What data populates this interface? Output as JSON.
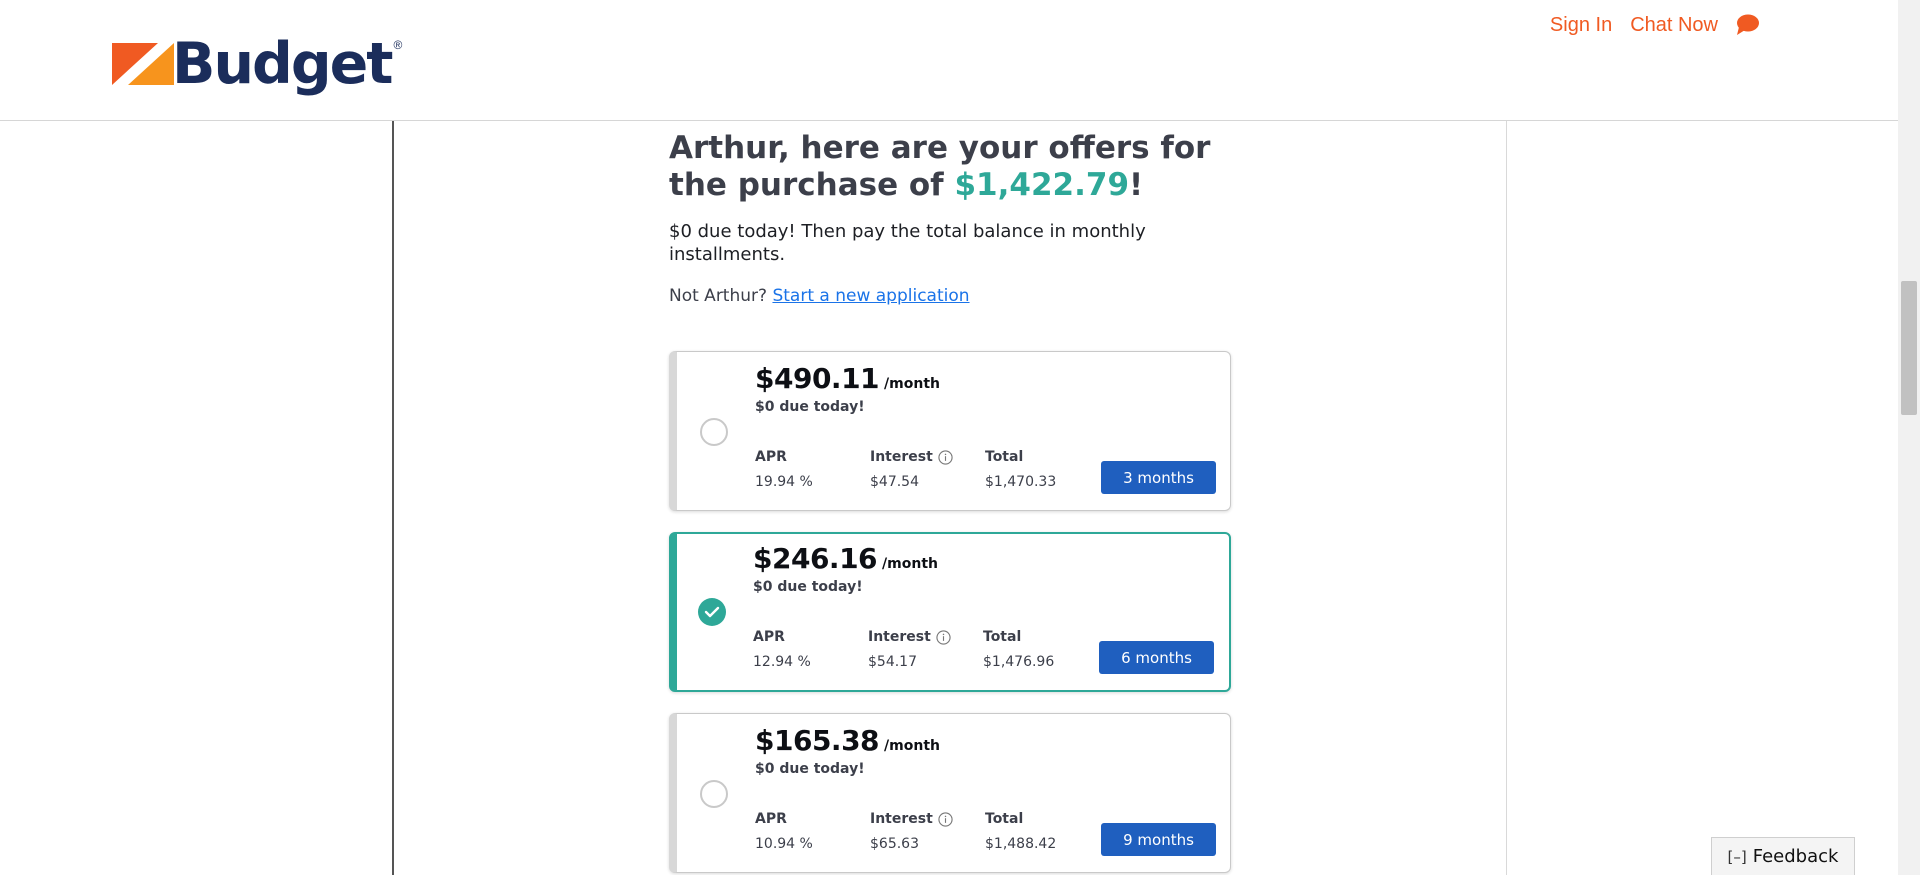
{
  "header": {
    "logo_text": "Budget",
    "logo_registered": "®",
    "sign_in": "Sign In",
    "chat_now": "Chat Now",
    "brand_color": "#f05a22",
    "logo_color": "#1b2d5b"
  },
  "main": {
    "headline_prefix": "Arthur, here are your offers for the purchase of ",
    "headline_amount": "$1,422.79",
    "headline_suffix": "!",
    "subtext": "$0 due today! Then pay the total balance in monthly installments.",
    "not_user_prefix": "Not Arthur?",
    "start_new_application": "Start a new application",
    "accent_color": "#2ea898"
  },
  "offers": [
    {
      "price": "$490.11",
      "per_month": "/month",
      "due_today": "$0 due today!",
      "apr_label": "APR",
      "apr_value": "19.94 %",
      "interest_label": "Interest",
      "interest_value": "$47.54",
      "total_label": "Total",
      "total_value": "$1,470.33",
      "term": "3 months",
      "selected": false
    },
    {
      "price": "$246.16",
      "per_month": "/month",
      "due_today": "$0 due today!",
      "apr_label": "APR",
      "apr_value": "12.94 %",
      "interest_label": "Interest",
      "interest_value": "$54.17",
      "total_label": "Total",
      "total_value": "$1,476.96",
      "term": "6 months",
      "selected": true
    },
    {
      "price": "$165.38",
      "per_month": "/month",
      "due_today": "$0 due today!",
      "apr_label": "APR",
      "apr_value": "10.94 %",
      "interest_label": "Interest",
      "interest_value": "$65.63",
      "total_label": "Total",
      "total_value": "$1,488.42",
      "term": "9 months",
      "selected": false
    }
  ],
  "feedback": {
    "bracket": "[–]",
    "label": "Feedback"
  }
}
